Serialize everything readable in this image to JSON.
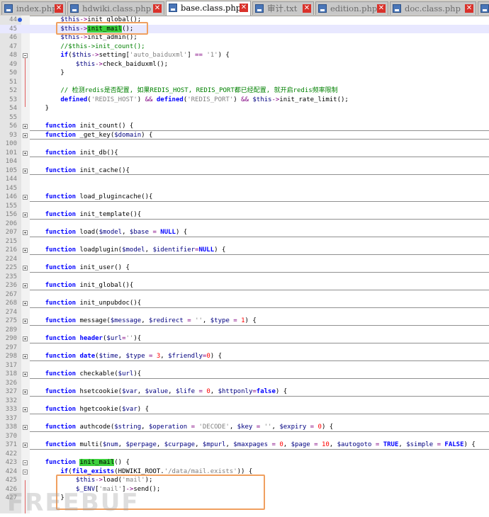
{
  "tabs": [
    {
      "label": "index.php",
      "active": false
    },
    {
      "label": "hdwiki.class.php",
      "active": false
    },
    {
      "label": "base.class.php",
      "active": true
    },
    {
      "label": "审计.txt",
      "active": false
    },
    {
      "label": "edition.php",
      "active": false
    },
    {
      "label": "doc.class.php",
      "active": false
    },
    {
      "label": "g",
      "active": false
    }
  ],
  "lines": [
    {
      "n": "44",
      "html": "        <span class=\"var\">$this</span><span class=\"op\">-></span>init_global();",
      "bookmark": true
    },
    {
      "n": "45",
      "html": "        <span class=\"var\">$this</span><span class=\"op\">-></span><span class=\"hl\">init_mail</span>();",
      "cur": true
    },
    {
      "n": "46",
      "html": "        <span class=\"var\">$this</span><span class=\"op\">-></span>init_admin();"
    },
    {
      "n": "47",
      "html": "        <span class=\"cmt\">//$this->init_count();</span>"
    },
    {
      "n": "48",
      "html": "        <span class=\"kw\">if</span>(<span class=\"var\">$this</span><span class=\"op\">-></span>setting[<span class=\"str\">'auto_baiduxml'</span>] <span class=\"op\">==</span> <span class=\"str\">'1'</span>) {",
      "fold": "minus"
    },
    {
      "n": "49",
      "html": "            <span class=\"var\">$this</span><span class=\"op\">-></span>check_baiduxml();"
    },
    {
      "n": "50",
      "html": "        }"
    },
    {
      "n": "51",
      "html": ""
    },
    {
      "n": "52",
      "html": "        <span class=\"cmt\">// 检测redis是否配置, 如果REDIS_HOST, REDIS_PORT都已经配置, 就开启redis频率限制</span>"
    },
    {
      "n": "53",
      "html": "        <span class=\"kw\">defined</span>(<span class=\"str\">'REDIS_HOST'</span>) <span class=\"op\">&&</span> <span class=\"kw\">defined</span>(<span class=\"str\">'REDIS_PORT'</span>) <span class=\"op\">&&</span> <span class=\"var\">$this</span><span class=\"op\">-></span>init_rate_limit();"
    },
    {
      "n": "54",
      "html": "    }"
    },
    {
      "n": "55",
      "html": ""
    },
    {
      "n": "56",
      "html": "    <span class=\"kw\">function</span> init_count() {",
      "fold": "plus",
      "sep": true
    },
    {
      "n": "93",
      "html": "    <span class=\"kw\">function</span> _get_key(<span class=\"var\">$domain</span>) {",
      "fold": "plus",
      "sep": true
    },
    {
      "n": "100",
      "html": ""
    },
    {
      "n": "101",
      "html": "    <span class=\"kw\">function</span> init_db(){",
      "fold": "plus",
      "sep": true
    },
    {
      "n": "104",
      "html": ""
    },
    {
      "n": "105",
      "html": "    <span class=\"kw\">function</span> init_cache(){",
      "fold": "plus",
      "sep": true
    },
    {
      "n": "144",
      "html": ""
    },
    {
      "n": "145",
      "html": ""
    },
    {
      "n": "146",
      "html": "    <span class=\"kw\">function</span> load_plugincache(){",
      "fold": "plus",
      "sep": true
    },
    {
      "n": "155",
      "html": ""
    },
    {
      "n": "156",
      "html": "    <span class=\"kw\">function</span> init_template(){",
      "fold": "plus",
      "sep": true
    },
    {
      "n": "206",
      "html": ""
    },
    {
      "n": "207",
      "html": "    <span class=\"kw\">function</span> load(<span class=\"var\">$model</span>, <span class=\"var\">$base</span> <span class=\"op\">=</span> <span class=\"kw\">NULL</span>) {",
      "fold": "plus",
      "sep": true
    },
    {
      "n": "215",
      "html": ""
    },
    {
      "n": "216",
      "html": "    <span class=\"kw\">function</span> loadplugin(<span class=\"var\">$model</span>, <span class=\"var\">$identifier</span><span class=\"op\">=</span><span class=\"kw\">NULL</span>) {",
      "fold": "plus",
      "sep": true
    },
    {
      "n": "224",
      "html": ""
    },
    {
      "n": "225",
      "html": "    <span class=\"kw\">function</span> init_user() {",
      "fold": "plus",
      "sep": true
    },
    {
      "n": "235",
      "html": ""
    },
    {
      "n": "236",
      "html": "    <span class=\"kw\">function</span> init_global(){",
      "fold": "plus",
      "sep": true
    },
    {
      "n": "267",
      "html": ""
    },
    {
      "n": "268",
      "html": "    <span class=\"kw\">function</span> init_unpubdoc(){",
      "fold": "plus",
      "sep": true
    },
    {
      "n": "274",
      "html": ""
    },
    {
      "n": "275",
      "html": "    <span class=\"kw\">function</span> message(<span class=\"var\">$message</span>, <span class=\"var\">$redirect</span> <span class=\"op\">=</span> <span class=\"str\">''</span>, <span class=\"var\">$type</span> <span class=\"op\">=</span> <span class=\"num2\">1</span>) {",
      "fold": "plus",
      "sep": true
    },
    {
      "n": "289",
      "html": ""
    },
    {
      "n": "290",
      "html": "    <span class=\"kw\">function</span> <span class=\"kw\">header</span>(<span class=\"var\">$url</span><span class=\"op\">=</span><span class=\"str\">''</span>){",
      "fold": "plus",
      "sep": true
    },
    {
      "n": "297",
      "html": ""
    },
    {
      "n": "298",
      "html": "    <span class=\"kw\">function</span> <span class=\"kw\">date</span>(<span class=\"var\">$time</span>, <span class=\"var\">$type</span> <span class=\"op\">=</span> <span class=\"num2\">3</span>, <span class=\"var\">$friendly</span><span class=\"op\">=</span><span class=\"num2\">0</span>) {",
      "fold": "plus",
      "sep": true
    },
    {
      "n": "317",
      "html": ""
    },
    {
      "n": "318",
      "html": "    <span class=\"kw\">function</span> checkable(<span class=\"var\">$url</span>){",
      "fold": "plus",
      "sep": true
    },
    {
      "n": "326",
      "html": ""
    },
    {
      "n": "327",
      "html": "    <span class=\"kw\">function</span> hsetcookie(<span class=\"var\">$var</span>, <span class=\"var\">$value</span>, <span class=\"var\">$life</span> <span class=\"op\">=</span> <span class=\"num2\">0</span>, <span class=\"var\">$httponly</span><span class=\"op\">=</span><span class=\"kw\">false</span>) {",
      "fold": "plus",
      "sep": true
    },
    {
      "n": "332",
      "html": ""
    },
    {
      "n": "333",
      "html": "    <span class=\"kw\">function</span> hgetcookie(<span class=\"var\">$var</span>) {",
      "fold": "plus",
      "sep": true
    },
    {
      "n": "337",
      "html": ""
    },
    {
      "n": "338",
      "html": "    <span class=\"kw\">function</span> authcode(<span class=\"var\">$string</span>, <span class=\"var\">$operation</span> <span class=\"op\">=</span> <span class=\"str\">'DECODE'</span>, <span class=\"var\">$key</span> <span class=\"op\">=</span> <span class=\"str\">''</span>, <span class=\"var\">$expiry</span> <span class=\"op\">=</span> <span class=\"num2\">0</span>) {",
      "fold": "plus",
      "sep": true
    },
    {
      "n": "370",
      "html": ""
    },
    {
      "n": "371",
      "html": "    <span class=\"kw\">function</span> multi(<span class=\"var\">$num</span>, <span class=\"var\">$perpage</span>, <span class=\"var\">$curpage</span>, <span class=\"var\">$mpurl</span>, <span class=\"var\">$maxpages</span> <span class=\"op\">=</span> <span class=\"num2\">0</span>, <span class=\"var\">$page</span> <span class=\"op\">=</span> <span class=\"num2\">10</span>, <span class=\"var\">$autogoto</span> <span class=\"op\">=</span> <span class=\"kw\">TRUE</span>, <span class=\"var\">$simple</span> <span class=\"op\">=</span> <span class=\"kw\">FALSE</span>) {",
      "fold": "plus",
      "sep": true
    },
    {
      "n": "422",
      "html": ""
    },
    {
      "n": "423",
      "html": "    <span class=\"kw\">function</span> <span class=\"hl\">init_mail</span>() {",
      "fold": "minus"
    },
    {
      "n": "424",
      "html": "        <span class=\"kw\">if</span>(<span class=\"kw\">file_exists</span>(HDWIKI_ROOT.<span class=\"str\">'/data/mail.exists'</span>)) {",
      "fold": "minus"
    },
    {
      "n": "425",
      "html": "            <span class=\"var\">$this</span><span class=\"op\">-></span>load(<span class=\"str\">'mail'</span>);"
    },
    {
      "n": "426",
      "html": "            <span class=\"var\">$_ENV</span>[<span class=\"str\">'mail'</span>]<span class=\"op\">-></span>send();"
    },
    {
      "n": "427",
      "html": "        }"
    }
  ]
}
